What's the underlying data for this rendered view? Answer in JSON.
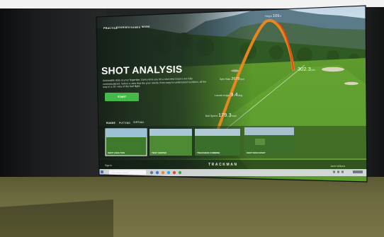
{
  "screen": {
    "nav_tabs": [
      {
        "label": "PRACTICE",
        "active": true
      },
      {
        "label": "COURSES",
        "active": false
      },
      {
        "label": "GAMES",
        "active": false
      },
      {
        "label": "MORE",
        "active": false
      }
    ],
    "title": "SHOT ANALYSIS",
    "description": "Actionable data at your fingertips. Every time you hit a shot new tracers are fully conceptualized. Select a view that fits your needs, from easy-to-understand numbers, all the way to a 3D view of the ball flight.",
    "start_button": "START",
    "sub_tabs": [
      {
        "label": "RANGE",
        "active": true
      },
      {
        "label": "PUTTING",
        "active": false
      },
      {
        "label": "VIRTUAL",
        "active": false
      }
    ],
    "stats": {
      "height": {
        "label": "Height",
        "value": "109",
        "unit": "ft"
      },
      "total": {
        "value": "302.3",
        "unit": "yds"
      },
      "ball_speed": {
        "label": "Ball Speed",
        "value": "179.3",
        "unit": "mph"
      },
      "launch_angle": {
        "label": "Launch Angle",
        "value": "9.4",
        "unit": "deg"
      },
      "spin_rate": {
        "label": "Spin Rate",
        "value": "2679",
        "unit": "rpm"
      }
    },
    "cards": [
      {
        "label": "SHOT ANALYSIS"
      },
      {
        "label": "TEST CENTER"
      },
      {
        "label": "TRACKMAN COMBINE"
      },
      {
        "label": "SHOT DISCOVERY"
      }
    ],
    "footer": {
      "sign_in": "Sign in",
      "brand": "TRACKMAN",
      "user": "Jamie Williams"
    },
    "taskbar": {
      "search_placeholder": "Type here to search"
    }
  },
  "colors": {
    "accent_green": "#45b84a",
    "trace_orange": "#f28a1e",
    "trace_red": "#e0421c"
  }
}
